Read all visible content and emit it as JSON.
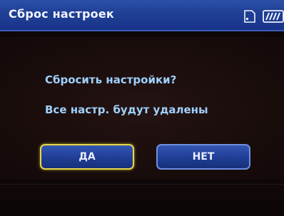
{
  "header": {
    "title": "Сброс настроек",
    "icons": [
      "sd-card-icon",
      "battery-icon"
    ]
  },
  "dialog": {
    "question": "Сбросить настройки?",
    "warning": "Все настр. будут удалены",
    "yes_label": "ДА",
    "no_label": "НЕТ",
    "selected": "yes"
  },
  "colors": {
    "title_bar": "#1f3f95",
    "text_accent": "#9fd0ff",
    "button": "#213f97",
    "focus_border": "#e8d84a"
  }
}
